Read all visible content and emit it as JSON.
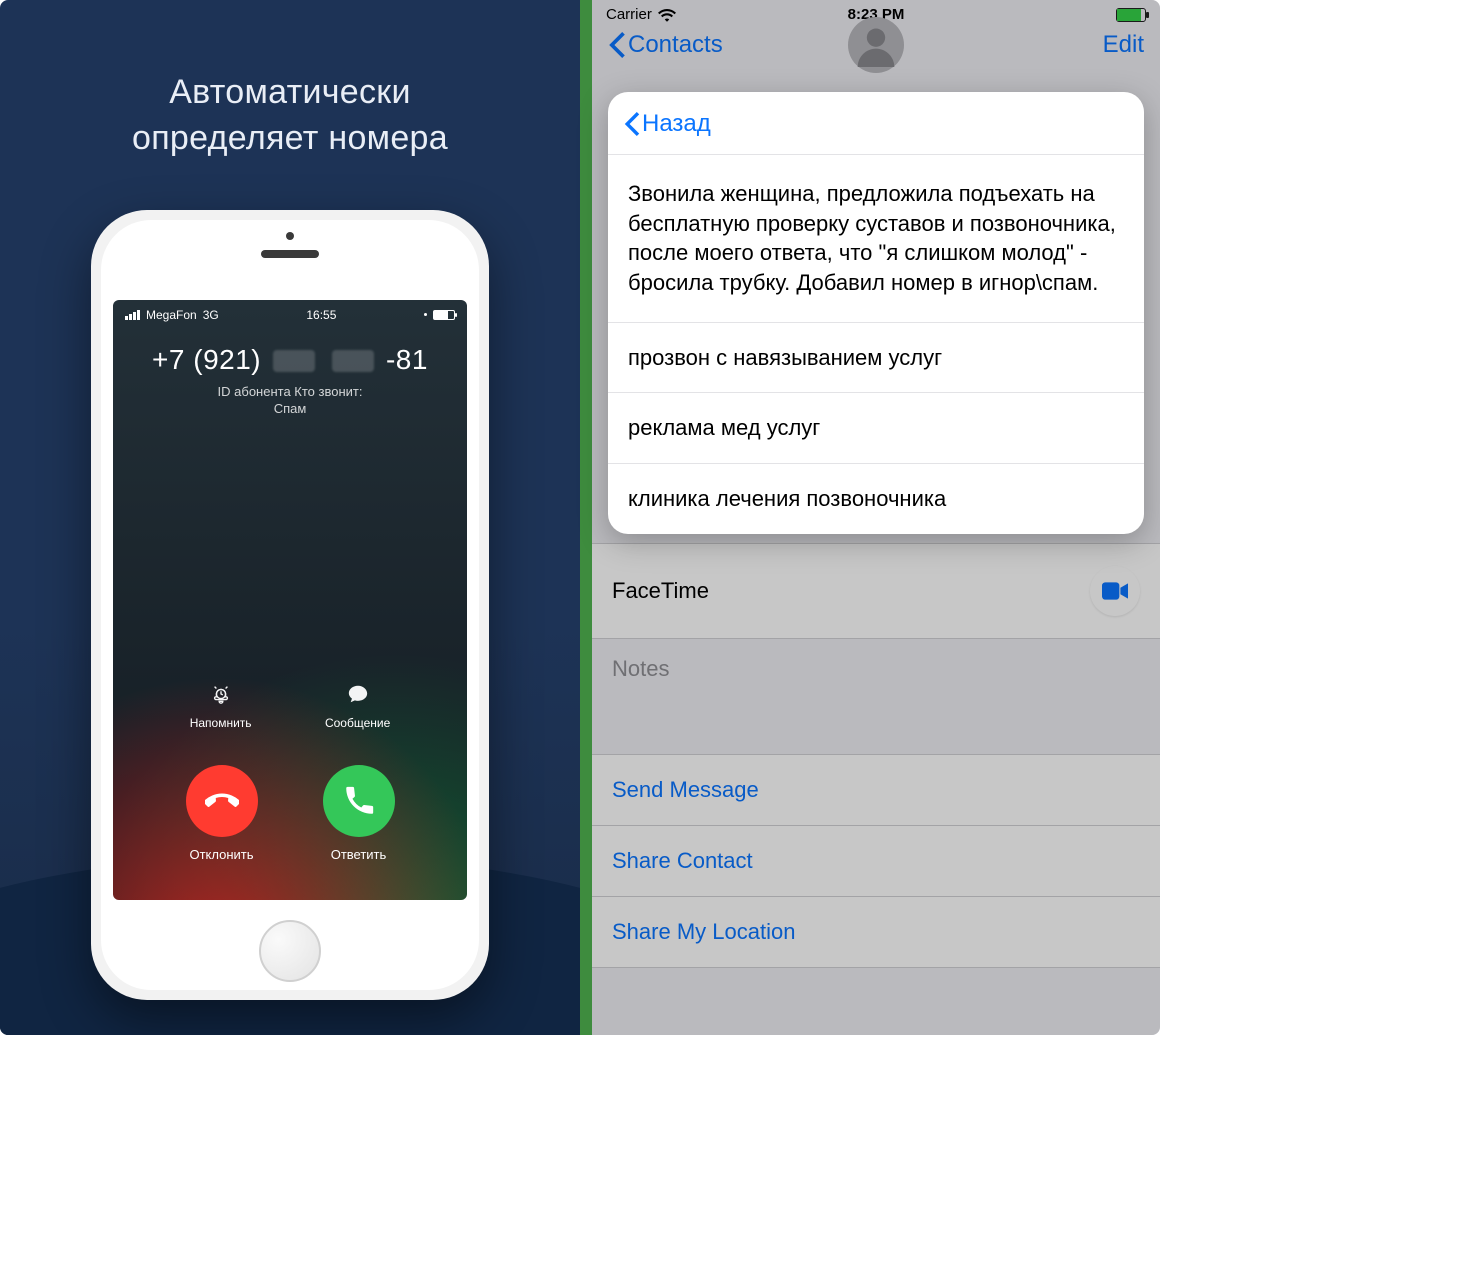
{
  "left": {
    "headline_l1": "Автоматически",
    "headline_l2": "определяет номера",
    "statusbar": {
      "carrier": "MegaFon",
      "network": "3G",
      "time": "16:55"
    },
    "call": {
      "number_prefix": "+7 (921)",
      "number_suffix": "-81",
      "id_label": "ID абонента Кто звонит:",
      "id_value": "Спам"
    },
    "mid": {
      "remind": "Напомнить",
      "message": "Сообщение"
    },
    "bottom": {
      "decline": "Отклонить",
      "answer": "Ответить"
    }
  },
  "right": {
    "statusbar": {
      "carrier": "Carrier",
      "time": "8:23 PM"
    },
    "nav": {
      "back": "Contacts",
      "edit": "Edit"
    },
    "rows": {
      "facetime": "FaceTime",
      "notes": "Notes",
      "send_message": "Send Message",
      "share_contact": "Share Contact",
      "share_location": "Share My Location"
    },
    "sheet": {
      "back": "Назад",
      "items": [
        "Звонила женщина, предложила подъехать на бесплатную проверку суставов и позвоночника, после моего ответа, что \"я слишком молод\" - бросила трубку. Добавил номер в игнор\\спам.",
        "прозвон с навязыванием услуг",
        "реклама мед услуг",
        "клиника лечения позвоночника"
      ]
    }
  }
}
